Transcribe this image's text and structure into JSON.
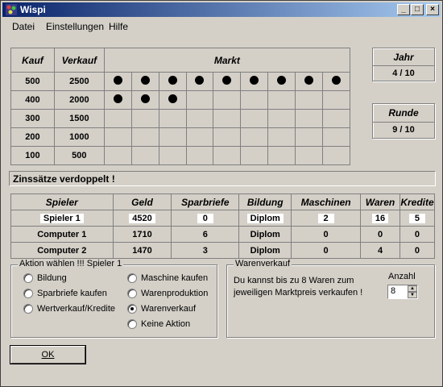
{
  "window": {
    "title": "Wispi"
  },
  "menu": [
    "Datei",
    "Einstellungen",
    "Hilfe"
  ],
  "market": {
    "headers": {
      "buy": "Kauf",
      "sell": "Verkauf",
      "market": "Markt"
    },
    "rows": [
      {
        "buy": "500",
        "sell": "2500",
        "dots": 9
      },
      {
        "buy": "400",
        "sell": "2000",
        "dots": 3
      },
      {
        "buy": "300",
        "sell": "1500",
        "dots": 0
      },
      {
        "buy": "200",
        "sell": "1000",
        "dots": 0
      },
      {
        "buy": "100",
        "sell": "500",
        "dots": 0
      }
    ],
    "columns": 9
  },
  "year": {
    "label": "Jahr",
    "value": "4 / 10"
  },
  "round": {
    "label": "Runde",
    "value": "9 / 10"
  },
  "status_message": "Zinssätze verdoppelt !",
  "players": {
    "headers": [
      "Spieler",
      "Geld",
      "Sparbriefe",
      "Bildung",
      "Maschinen",
      "Waren",
      "Kredite"
    ],
    "rows": [
      [
        "Spieler 1",
        "4520",
        "0",
        "Diplom",
        "2",
        "16",
        "5"
      ],
      [
        "Computer 1",
        "1710",
        "6",
        "Diplom",
        "0",
        "0",
        "0"
      ],
      [
        "Computer 2",
        "1470",
        "3",
        "Diplom",
        "0",
        "4",
        "0"
      ]
    ]
  },
  "action": {
    "title": "Aktion wählen !!! Spieler 1",
    "options_left": [
      "Bildung",
      "Sparbriefe kaufen",
      "Wertverkauf/Kredite"
    ],
    "options_right": [
      "Maschine kaufen",
      "Warenproduktion",
      "Warenverkauf",
      "Keine Aktion"
    ],
    "selected": "Warenverkauf"
  },
  "sale": {
    "title": "Warenverkauf",
    "text_line1": "Du kannst bis zu 8 Waren zum",
    "text_line2": "jeweiligen Marktpreis verkaufen !",
    "amount_label": "Anzahl",
    "amount_value": "8"
  },
  "ok_label": "OK"
}
